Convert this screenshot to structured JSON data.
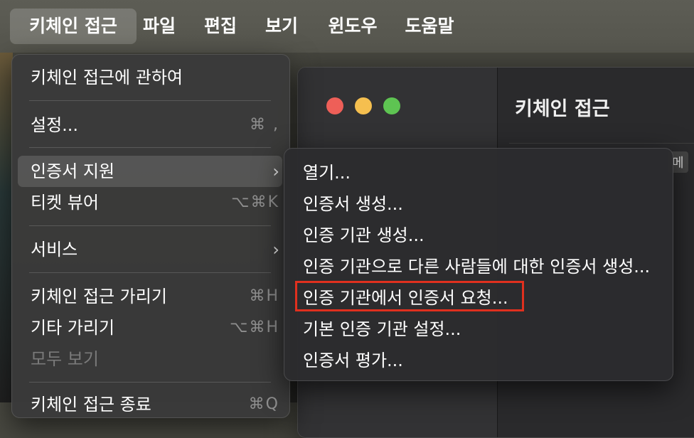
{
  "menubar": {
    "app": "키체인 접근",
    "items": [
      "파일",
      "편집",
      "보기",
      "윈도우",
      "도움말"
    ]
  },
  "background_window": {
    "title": "키체인 접근",
    "fragment": "메"
  },
  "main_menu": {
    "items": [
      {
        "label": "키체인 접근에 관하여",
        "shortcut": ""
      },
      {
        "label": "설정...",
        "shortcut": "⌘ ,"
      },
      {
        "label": "인증서 지원",
        "submenu": true
      },
      {
        "label": "티켓 뷰어",
        "shortcut": "⌥⌘K"
      },
      {
        "label": "서비스",
        "submenu": true
      },
      {
        "label": "키체인 접근 가리기",
        "shortcut": "⌘H"
      },
      {
        "label": "기타 가리기",
        "shortcut": "⌥⌘H"
      },
      {
        "label": "모두 보기",
        "disabled": true
      },
      {
        "label": "키체인 접근 종료",
        "shortcut": "⌘Q"
      }
    ]
  },
  "submenu": {
    "items": [
      "열기...",
      "인증서 생성...",
      "인증 기관 생성...",
      "인증 기관으로 다른 사람들에 대한 인증서 생성...",
      "인증 기관에서 인증서 요청...",
      "기본 인증 기관 설정...",
      "인증서 평가..."
    ],
    "highlighted_index": 4
  },
  "colors": {
    "highlight_box": "#e0301e",
    "close": "#ee5f58",
    "minimize": "#f5bf4f",
    "zoom": "#5ec452"
  }
}
